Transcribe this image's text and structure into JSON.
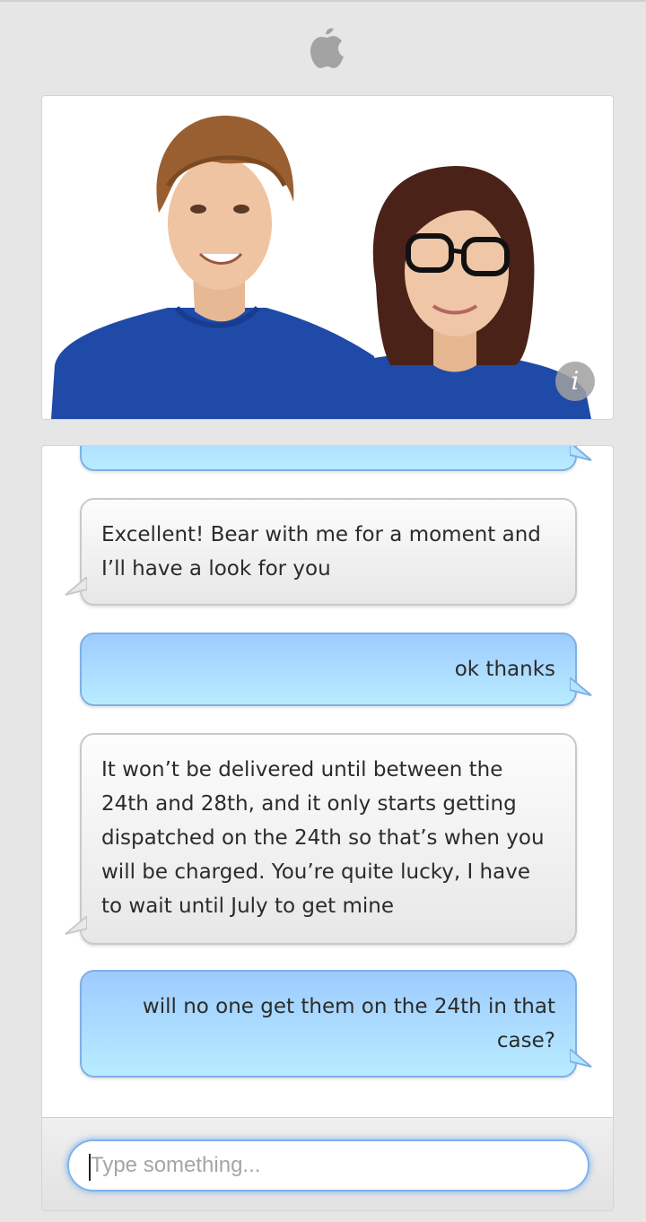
{
  "header": {
    "logo_icon": "apple-logo-icon"
  },
  "hero": {
    "photo_icon": "support-staff-photo",
    "info_label": "i",
    "colors": {
      "shirt": "#1f4aa8",
      "background": "#ffffff"
    }
  },
  "messages": [
    {
      "sender": "user",
      "text": ""
    },
    {
      "sender": "agent",
      "text": "Excellent! Bear with me for a moment and I’ll have a look for you"
    },
    {
      "sender": "user",
      "text": "ok thanks"
    },
    {
      "sender": "agent",
      "text": "It won’t be delivered until between the 24th and 28th, and it only starts getting dispatched on the 24th so that’s when you will be charged. You’re quite lucky, I have to wait until July to get mine"
    },
    {
      "sender": "user",
      "text": "will no one get them on the 24th in that case?"
    }
  ],
  "composer": {
    "placeholder": "Type something...",
    "value": ""
  },
  "colors": {
    "user_bubble": "#a8d6ff",
    "agent_bubble": "#eeeeee",
    "focus_ring": "#7fb3ef"
  }
}
